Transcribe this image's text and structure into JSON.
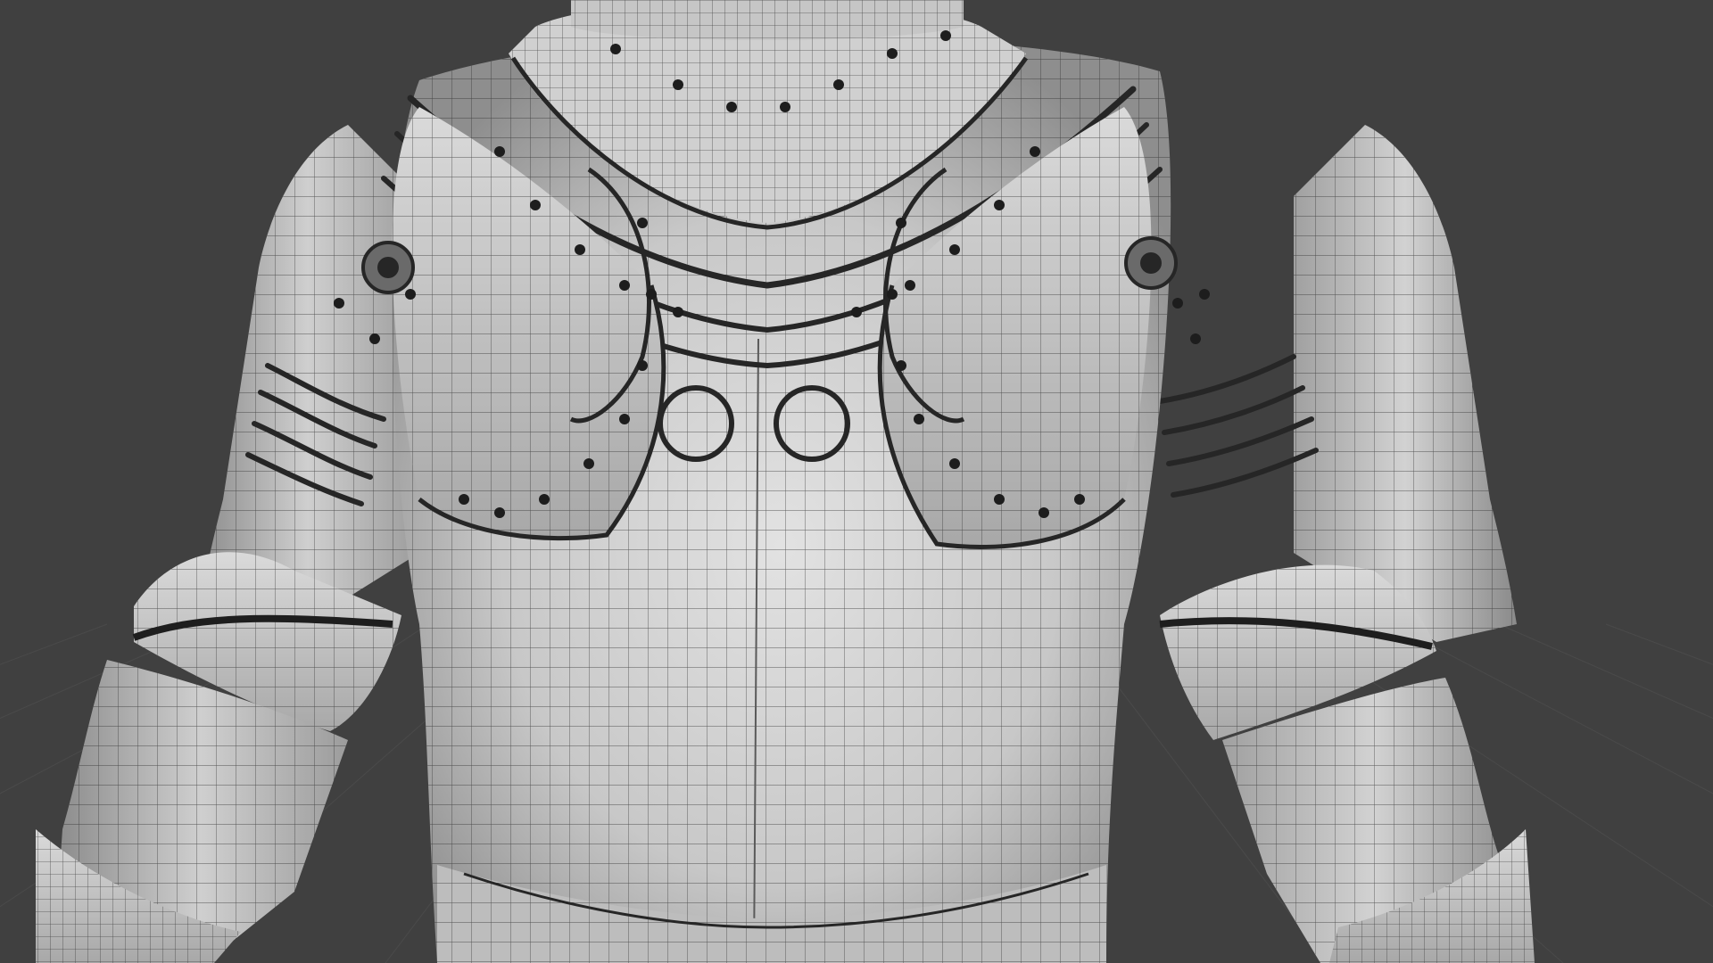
{
  "app": {
    "panel": "3d-viewport",
    "shading_mode": "solid-with-wireframe"
  },
  "scene": {
    "subject": "armor-torso-model",
    "colors": {
      "background": "#404040",
      "grid_line": "#4a4a4a",
      "surface_light": "#d8d8d8",
      "surface_mid": "#b4b4b4",
      "surface_dark": "#7c7c7c",
      "wire": "#2b2b2b",
      "rivet": "#1d1d1d",
      "trim": "#262626"
    }
  }
}
